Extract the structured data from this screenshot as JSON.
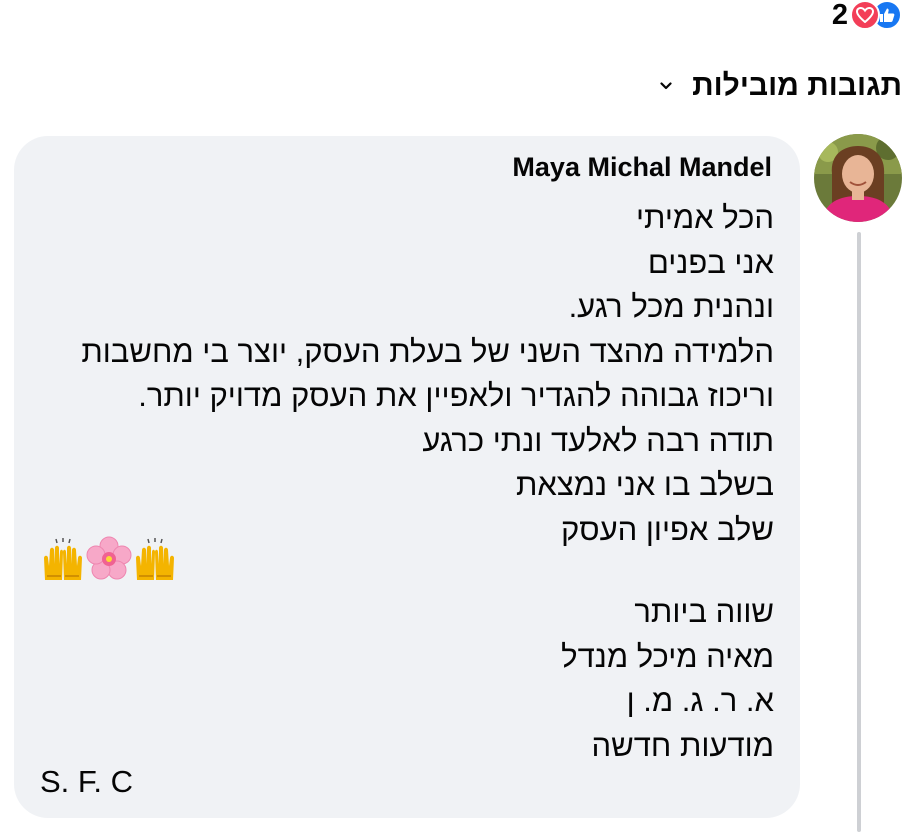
{
  "reactions": {
    "count": "2",
    "types": [
      "love-icon",
      "like-icon"
    ],
    "love_color": "#f33e58",
    "like_color": "#1877f2"
  },
  "sort": {
    "label": "תגובות מובילות"
  },
  "comment": {
    "author": "Maya Michal Mandel",
    "lines": [
      "הכל אמיתי",
      "אני בפנים",
      "ונהנית מכל רגע.",
      "הלמידה מהצד השני של בעלת העסק, יוצר בי מחשבות",
      "וריכוז גבוהה להגדיר ולאפיין את העסק מדויק יותר.",
      "תודה רבה לאלעד ונתי כרגע",
      "בשלב בו אני נמצאת",
      "שלב אפיון העסק"
    ],
    "emojis": [
      "raising-hands-emoji",
      "cherry-blossom-emoji",
      "raising-hands-emoji"
    ],
    "signature_lines": [
      "שווה ביותר",
      "מאיה מיכל מנדל",
      "א. ר. ג. מ. ן",
      "מודעות חדשה"
    ],
    "closing": "S. F. C",
    "bubble_color": "#f0f2f5"
  }
}
